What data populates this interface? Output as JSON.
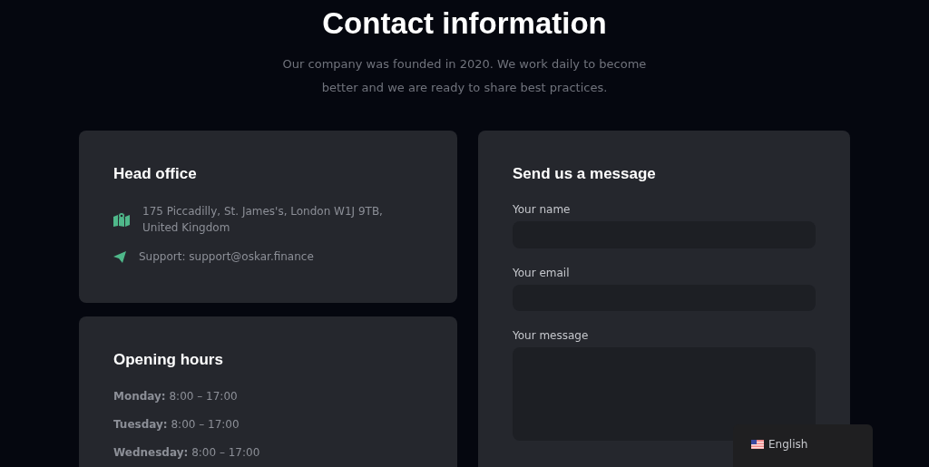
{
  "header": {
    "title": "Contact information",
    "subtitle": "Our company was founded in 2020. We work daily to become better and we are ready to share best practices."
  },
  "head_office": {
    "title": "Head office",
    "items": [
      {
        "kind": "address",
        "text": "175 Piccadilly, St. James's, London W1J 9TB, United Kingdom"
      },
      {
        "kind": "email",
        "text": "Support: support@oskar.finance"
      }
    ]
  },
  "opening_hours": {
    "title": "Opening hours",
    "rows": [
      "**Monday:** 8:00 – 17:00",
      "**Tuesday:** 8:00 – 17:00",
      "**Wednesday:** 8:00 – 17:00"
    ]
  },
  "message_form": {
    "title": "Send us a message",
    "fields": [
      {
        "kind": "input",
        "label": "Your name"
      },
      {
        "kind": "input",
        "label": "Your email"
      },
      {
        "kind": "textarea",
        "label": "Your message"
      }
    ]
  },
  "language_selector": {
    "label": "English"
  }
}
